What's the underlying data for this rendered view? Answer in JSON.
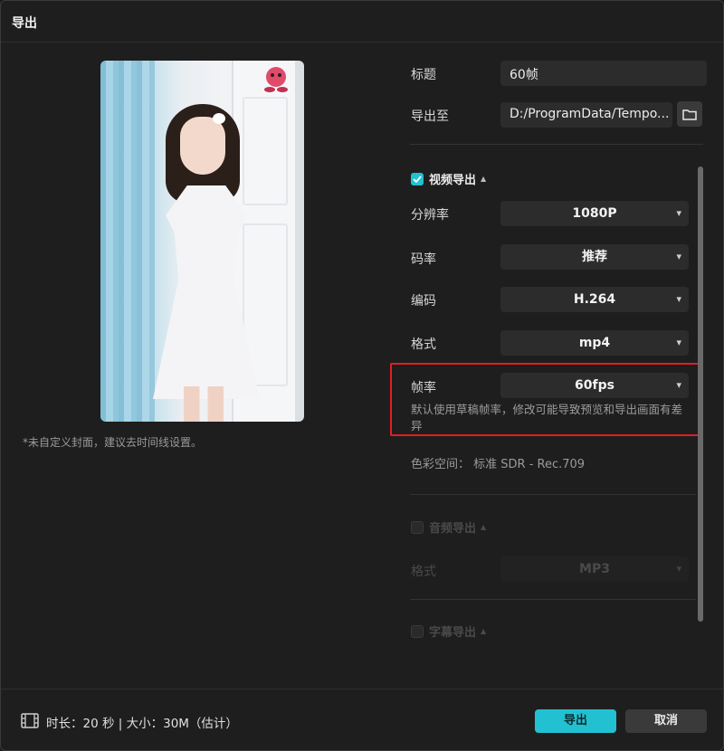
{
  "window": {
    "title": "导出"
  },
  "preview": {
    "cover_note": "*未自定义封面，建议去时间线设置。"
  },
  "settings": {
    "title_label": "标题",
    "title_value": "60帧",
    "export_to_label": "导出至",
    "export_to_value": "D:/ProgramData/Tempo...",
    "folder_icon": "folder-icon",
    "video_section": {
      "label": "视频导出",
      "checked": true
    },
    "resolution": {
      "label": "分辨率",
      "value": "1080P"
    },
    "bitrate": {
      "label": "码率",
      "value": "推荐"
    },
    "codec": {
      "label": "编码",
      "value": "H.264"
    },
    "format": {
      "label": "格式",
      "value": "mp4"
    },
    "framerate": {
      "label": "帧率",
      "value": "60fps",
      "note": "默认使用草稿帧率，修改可能导致预览和导出画面有差异"
    },
    "color_space": "色彩空间：  标准 SDR - Rec.709",
    "audio_section": {
      "label": "音频导出",
      "checked": false
    },
    "audio_format": {
      "label": "格式",
      "value": "MP3"
    },
    "subtitle_section": {
      "label": "字幕导出",
      "checked": false
    }
  },
  "footer": {
    "film_icon": "film-icon",
    "info": "时长：20 秒 | 大小：30M（估计）",
    "export_label": "导出",
    "cancel_label": "取消"
  },
  "colors": {
    "accent": "#22c1d2",
    "highlight": "#e02020",
    "background": "#1e1e1e"
  }
}
